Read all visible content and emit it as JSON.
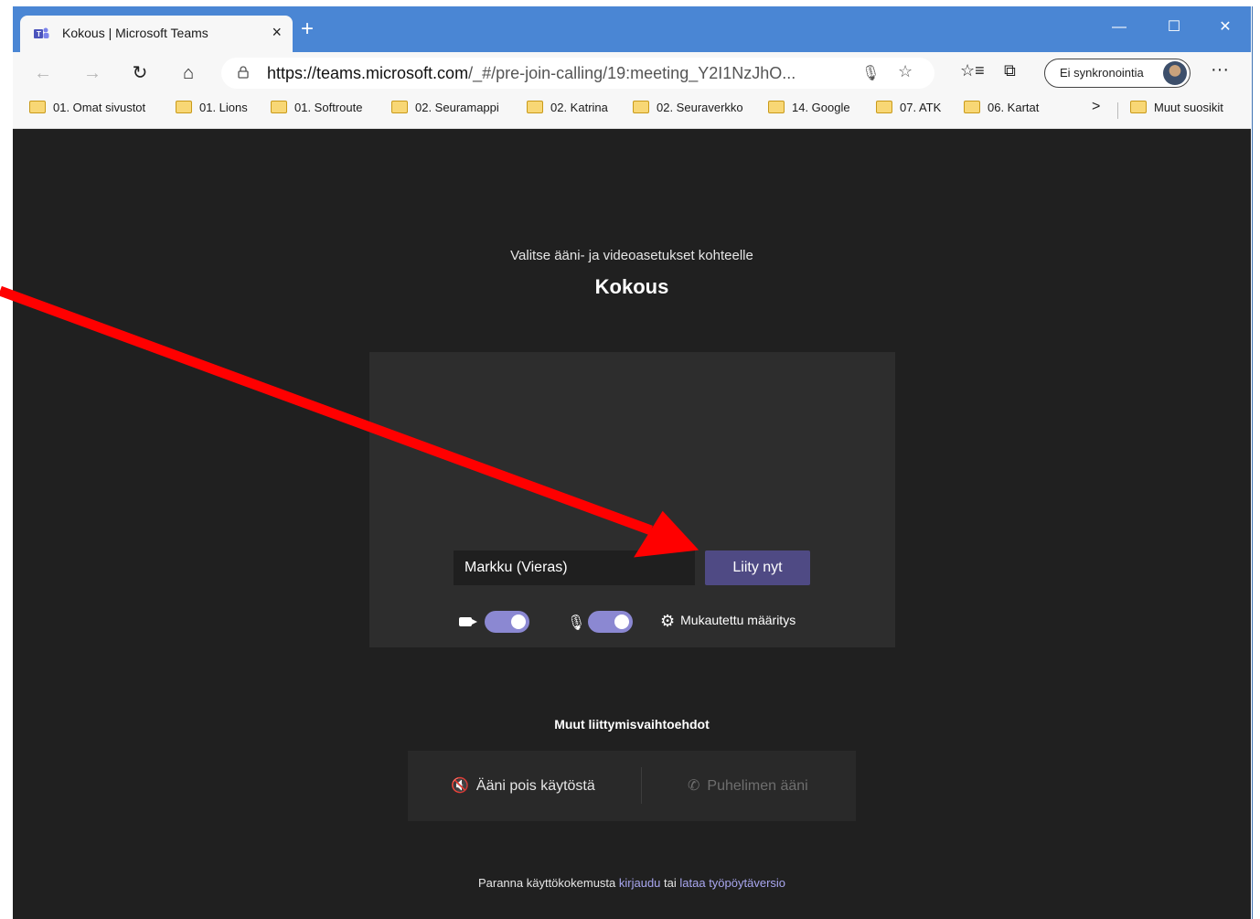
{
  "browser": {
    "tab_title": "Kokous | Microsoft Teams",
    "tab_close": "×",
    "new_tab": "+",
    "window_controls": {
      "minimize": "—",
      "maximize": "☐",
      "close": "✕"
    },
    "url_host": "https://teams.microsoft.com",
    "url_path": "/_#/pre-join-calling/19:meeting_Y2I1NzJhO...",
    "sync_label": "Ei synkronointia",
    "more_label": "···",
    "favorites": [
      "01. Omat sivustot",
      "01. Lions",
      "01. Softroute",
      "02. Seuramappi",
      "02. Katrina",
      "02. Seuraverkko",
      "14. Google",
      "07. ATK",
      "06. Kartat"
    ],
    "favorites_overflow": ">",
    "other_favorites": "Muut suosikit"
  },
  "prejoin": {
    "subtitle": "Valitse ääni- ja videoasetukset kohteelle",
    "meeting_title": "Kokous",
    "name_value": "Markku (Vieras)",
    "join_label": "Liity nyt",
    "camera_on": true,
    "mic_on": true,
    "settings_label": "Mukautettu määritys"
  },
  "other_options": {
    "title": "Muut liittymisvaihtoehdot",
    "audio_off_label": "Ääni pois käytöstä",
    "phone_audio_label": "Puhelimen ääni"
  },
  "footer": {
    "prefix": "Paranna käyttökokemusta ",
    "signin_link": "kirjaudu",
    "middle": " tai ",
    "download_link": "lataa työpöytäversio"
  },
  "colors": {
    "titlebar": "#4a86d4",
    "stage": "#202020",
    "join_button": "#4f4a84",
    "toggle": "#8b88d2",
    "link": "#a9a7f0",
    "annotation_arrow": "#ff0000"
  }
}
